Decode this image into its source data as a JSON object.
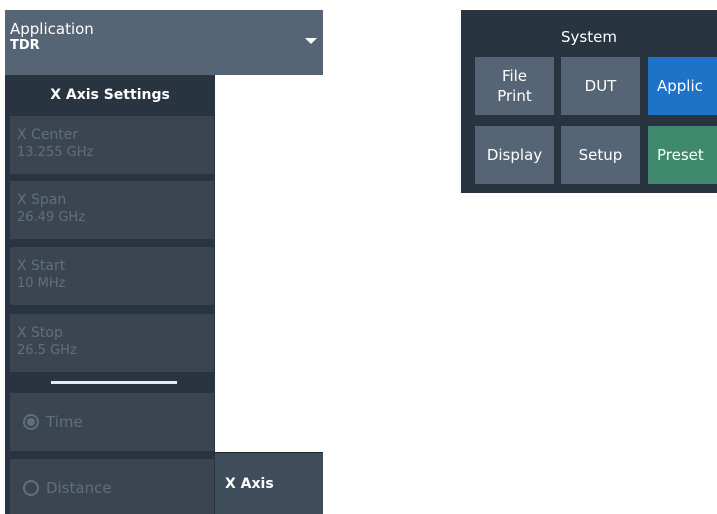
{
  "application": {
    "label": "Application",
    "value": "TDR"
  },
  "x_axis_settings": {
    "title": "X Axis Settings",
    "fields": [
      {
        "label": "X Center",
        "value": "13.255 GHz"
      },
      {
        "label": "X Span",
        "value": "26.49 GHz"
      },
      {
        "label": "X Start",
        "value": "10 MHz"
      },
      {
        "label": "X Stop",
        "value": "26.5 GHz"
      }
    ],
    "radio_options": [
      {
        "label": "Time",
        "selected": true
      },
      {
        "label": "Distance",
        "selected": false
      }
    ],
    "tab_label": "X Axis"
  },
  "system": {
    "title": "System",
    "buttons": [
      {
        "label": "File Print"
      },
      {
        "label": "DUT"
      },
      {
        "label": "Applic"
      },
      {
        "label": "Display"
      },
      {
        "label": "Setup"
      },
      {
        "label": "Preset"
      }
    ]
  },
  "colors": {
    "panel_dark": "#283440",
    "button_gray": "#566575",
    "disabled_button": "#3a4550",
    "disabled_text": "#606f7c",
    "application_blue": "#1e72c7",
    "preset_green": "#3f8a6c"
  }
}
